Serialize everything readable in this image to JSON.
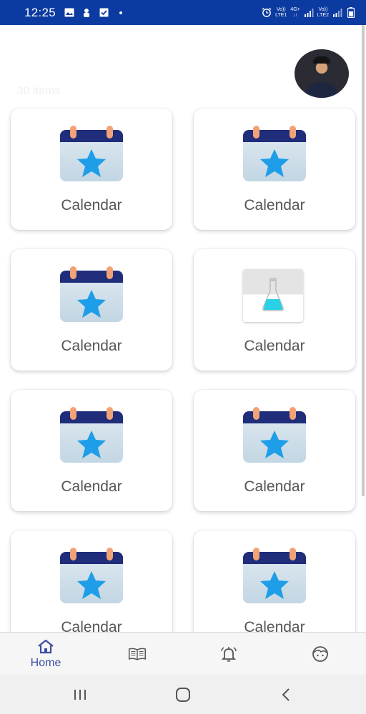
{
  "status_bar": {
    "time": "12:25",
    "left_icons": [
      "image-icon",
      "android-debug-icon",
      "checkbox-icon",
      "dot-icon"
    ],
    "sim1_top": "Vo))",
    "sim1_bottom": "LTE1",
    "network_type": "4G+",
    "sim2_top": "Vo))",
    "sim2_bottom": "LTE2",
    "right_icons": [
      "alarm-icon",
      "signal-icon",
      "signal-icon",
      "battery-icon"
    ]
  },
  "header": {
    "items_count": "30 items",
    "avatar": "profile-avatar"
  },
  "cards": [
    {
      "label": "Calendar",
      "icon": "calendar-star-icon"
    },
    {
      "label": "Calendar",
      "icon": "calendar-star-icon"
    },
    {
      "label": "Calendar",
      "icon": "calendar-star-icon"
    },
    {
      "label": "Calendar",
      "icon": "flask-icon"
    },
    {
      "label": "Calendar",
      "icon": "calendar-star-icon"
    },
    {
      "label": "Calendar",
      "icon": "calendar-star-icon"
    },
    {
      "label": "Calendar",
      "icon": "calendar-star-icon"
    },
    {
      "label": "Calendar",
      "icon": "calendar-star-icon"
    }
  ],
  "bottom_nav": {
    "items": [
      {
        "label": "Home",
        "icon": "home-icon",
        "active": true
      },
      {
        "label": "",
        "icon": "book-icon",
        "active": false
      },
      {
        "label": "",
        "icon": "bell-icon",
        "active": false
      },
      {
        "label": "",
        "icon": "face-icon",
        "active": false
      }
    ]
  },
  "system_nav": {
    "buttons": [
      "recent-apps-icon",
      "home-circle-icon",
      "back-icon"
    ]
  },
  "colors": {
    "status_bar": "#0b3aa0",
    "accent": "#3a4da6",
    "card_label": "#555555",
    "calendar_header": "#1f2d7a",
    "calendar_ring": "#f1a276",
    "star": "#1e9ee8"
  }
}
